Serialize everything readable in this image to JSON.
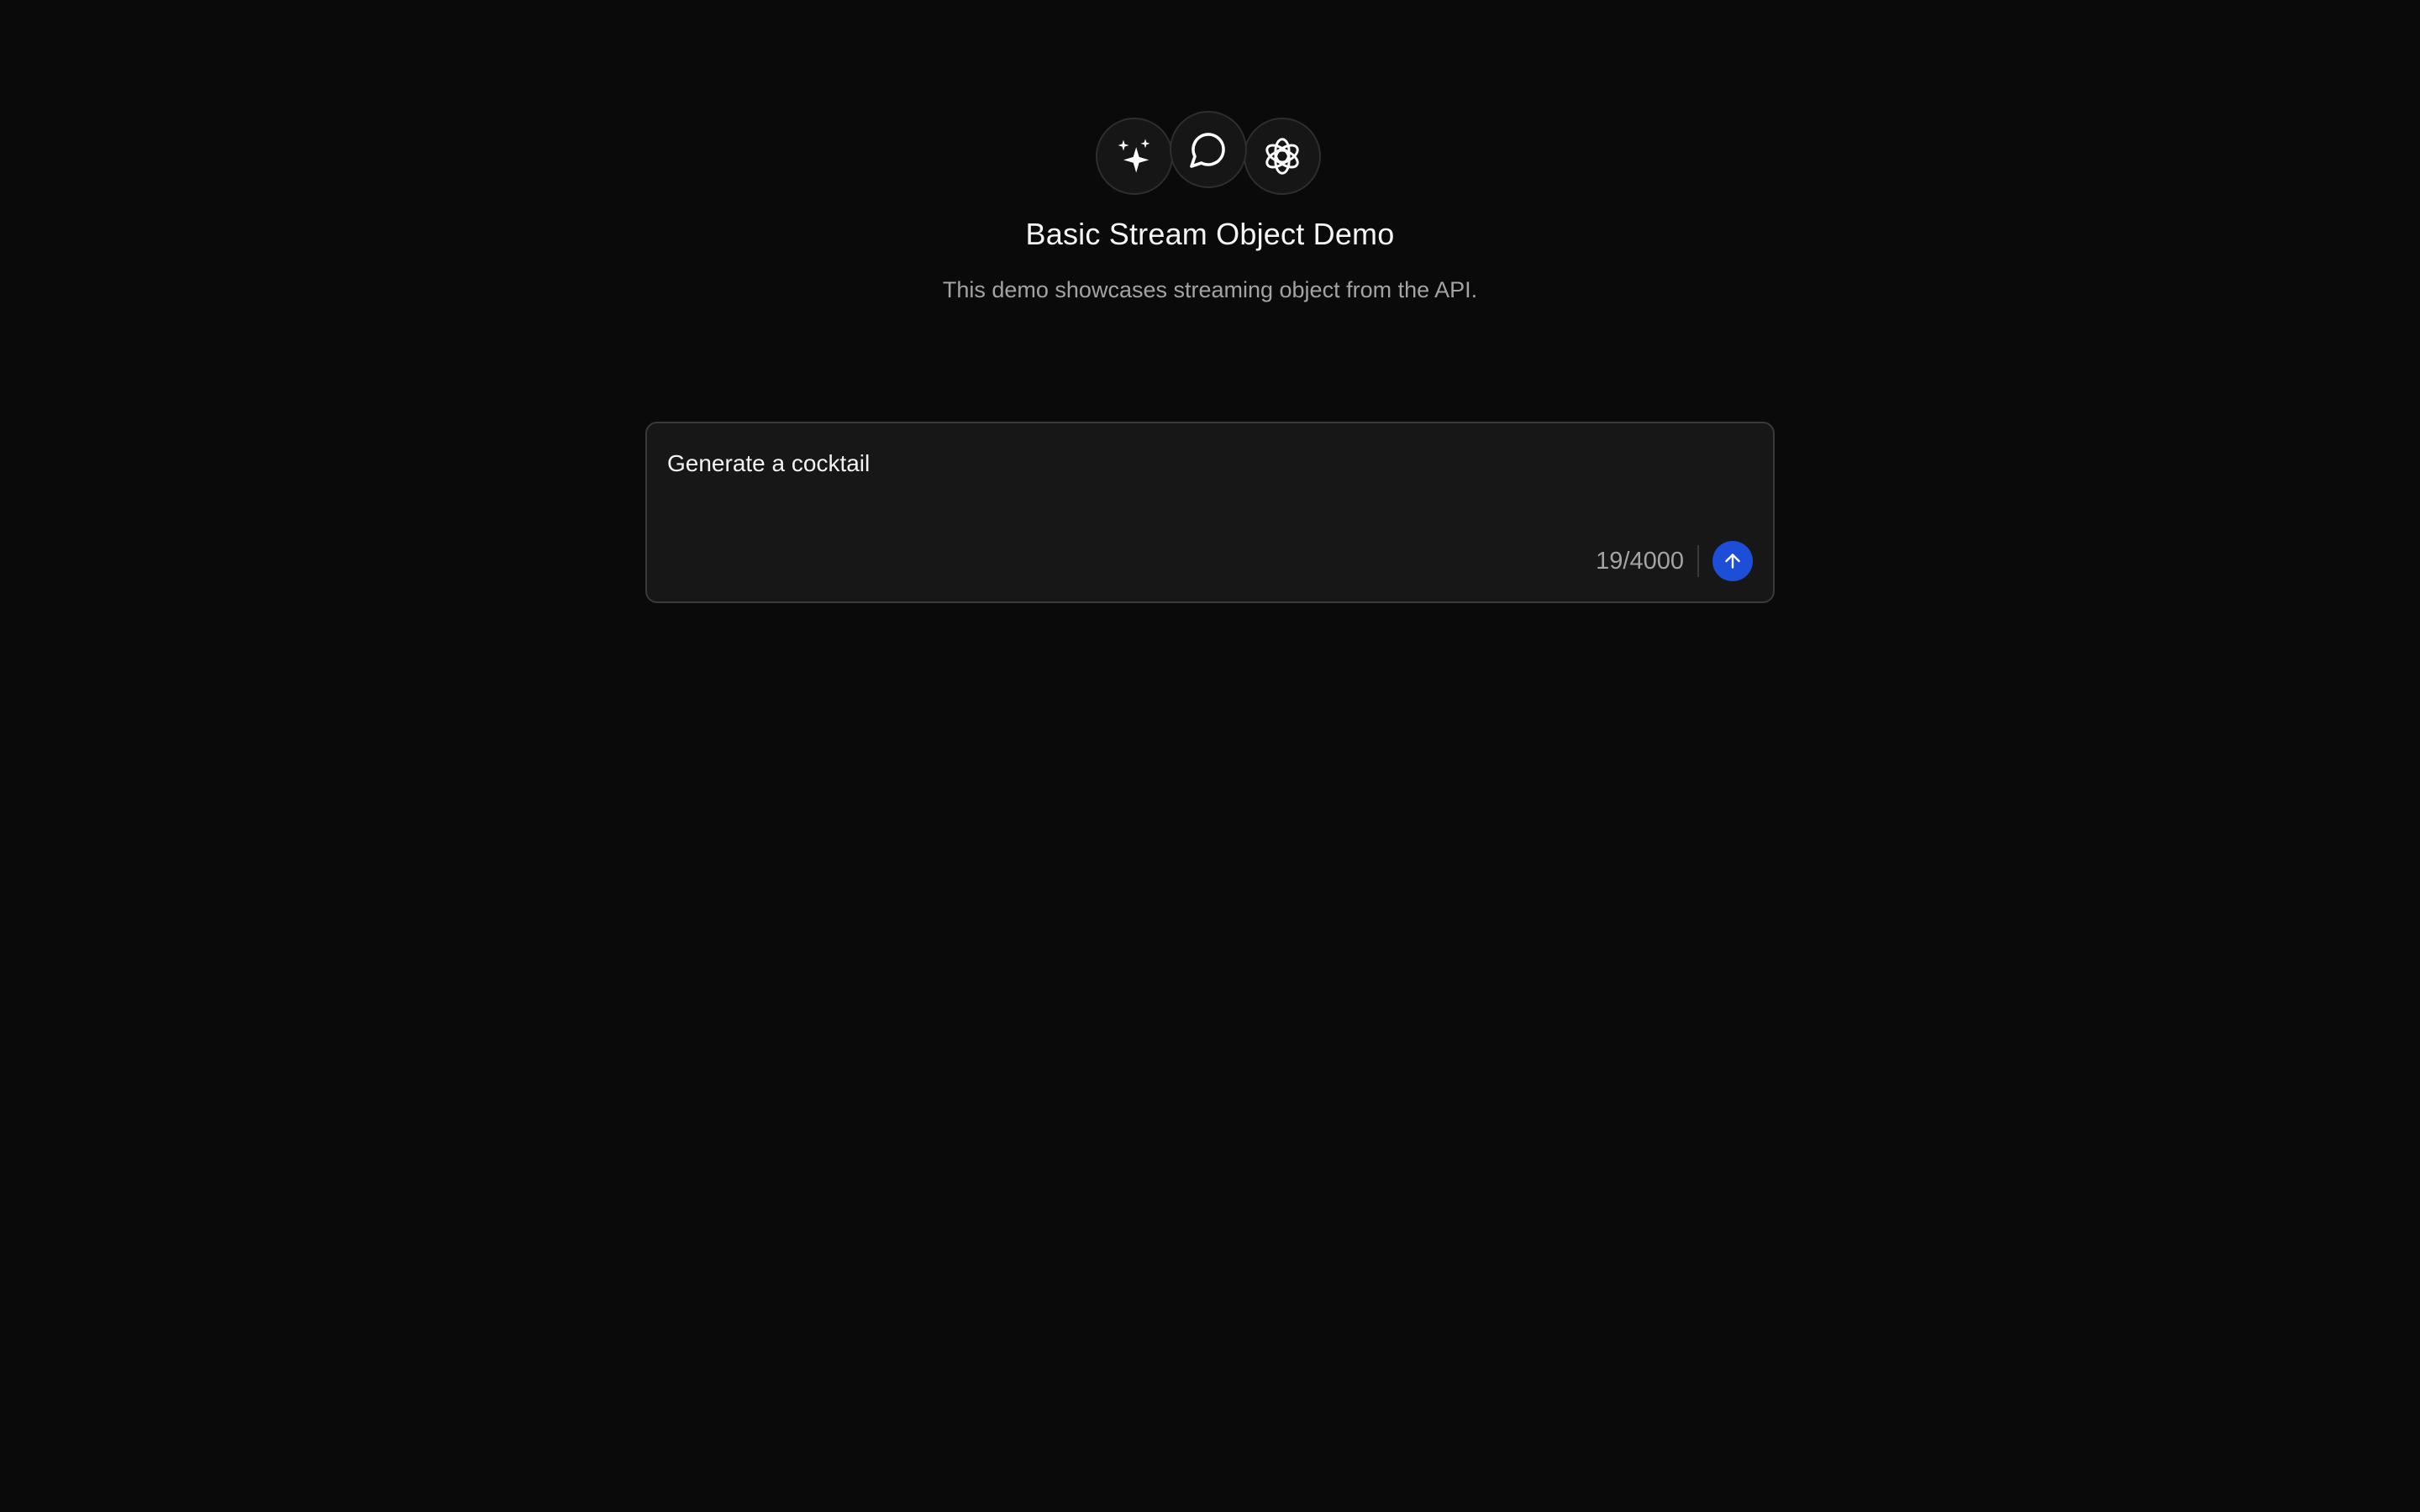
{
  "header": {
    "icons": [
      "sparkles-icon",
      "message-circle-icon",
      "openai-logo-icon"
    ],
    "title": "Basic Stream Object Demo",
    "subtitle": "This demo showcases streaming object from the API."
  },
  "composer": {
    "value": "Generate a cocktail",
    "char_count": "19/4000",
    "send_icon": "arrow-up-icon"
  },
  "colors": {
    "background": "#0a0a0a",
    "surface": "#171717",
    "border": "#3a3a3a",
    "muted_text": "#a3a3a3",
    "accent": "#1d4ed8"
  }
}
